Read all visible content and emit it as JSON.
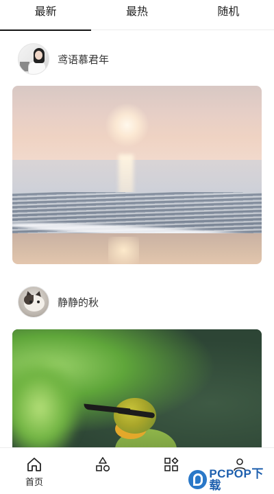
{
  "tabs": [
    {
      "label": "最新",
      "active": true
    },
    {
      "label": "最热",
      "active": false
    },
    {
      "label": "随机",
      "active": false
    }
  ],
  "posts": [
    {
      "username": "鸢语慕君年",
      "avatar": "woman-avatar",
      "image": "sunset-beach-photo"
    },
    {
      "username": "静静的秋",
      "avatar": "cat-avatar",
      "image": "bee-eater-bird-photo"
    }
  ],
  "bottom_nav": [
    {
      "label": "首页",
      "icon": "home-icon"
    },
    {
      "label": "",
      "icon": "shapes-icon"
    },
    {
      "label": "",
      "icon": "apps-grid-icon"
    },
    {
      "label": "",
      "icon": "user-icon"
    }
  ],
  "watermark": {
    "text": "PCPOP下载"
  },
  "colors": {
    "active_indicator": "#111111",
    "divider": "#ececec",
    "watermark": "#1d5fae"
  }
}
